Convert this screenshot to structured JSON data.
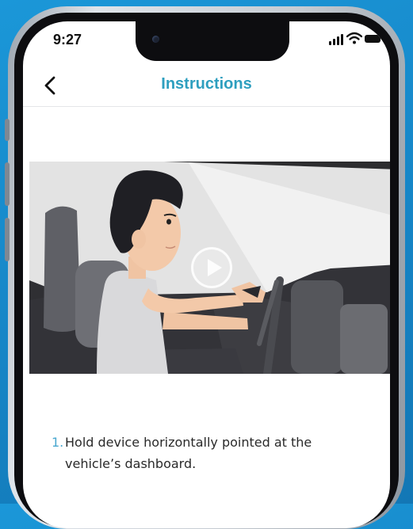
{
  "status_bar": {
    "time": "9:27",
    "icons": [
      "cellular-signal-icon",
      "wifi-icon",
      "battery-icon"
    ]
  },
  "header": {
    "back_icon": "chevron-left-icon",
    "title": "Instructions"
  },
  "video": {
    "play_icon": "play-icon"
  },
  "steps": [
    {
      "number": "1.",
      "text": "Hold device horizontally pointed at the vehicle’s dashboard."
    }
  ],
  "colors": {
    "background": "#1685c6",
    "title": "#2e9fbf",
    "step_number": "#4aa8d0",
    "text": "#2a2a2a"
  }
}
